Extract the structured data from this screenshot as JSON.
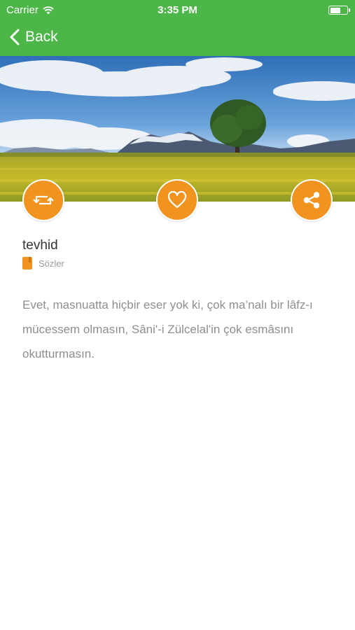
{
  "status_bar": {
    "carrier": "Carrier",
    "time": "3:35 PM"
  },
  "nav": {
    "back_label": "Back"
  },
  "colors": {
    "nav_green": "#4cb748",
    "accent_orange": "#f0931f"
  },
  "actions": [
    {
      "icon": "retweet-icon"
    },
    {
      "icon": "heart-icon"
    },
    {
      "icon": "share-icon"
    }
  ],
  "post": {
    "title": "tevhid",
    "category_icon": "book-icon",
    "category": "Sözler",
    "text": "Evet, masnuatta hiçbir eser yok ki, çok ma’nalı bir lâfz-ı mücessem olmasın, Sâni'-i Zülcelal'in çok esmâsını okutturmasın."
  }
}
